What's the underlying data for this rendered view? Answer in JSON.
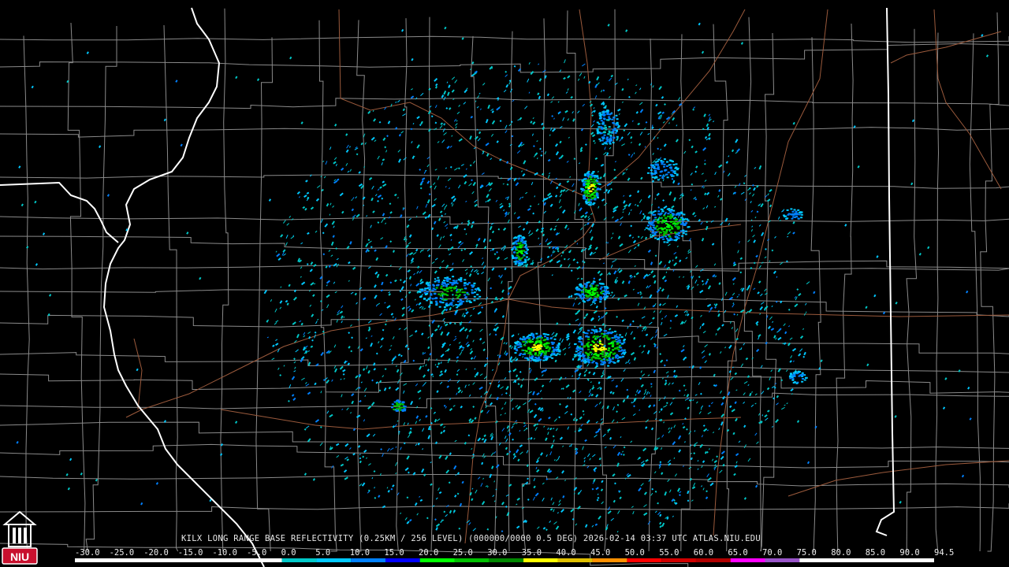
{
  "product": {
    "caption": "KILX LONG RANGE BASE REFLECTIVITY (0.25KM / 256 LEVEL) (000000/0000 0.5 DEG) 2026-02-14 03:37 UTC  ATLAS.NIU.EDU"
  },
  "logo": {
    "text": "NIU",
    "bg_color": "#c8102e"
  },
  "legend": {
    "ticks": [
      "-30.0",
      "-25.0",
      "-20.0",
      "-15.0",
      "-10.0",
      "-5.0",
      "0.0",
      "5.0",
      "10.0",
      "15.0",
      "20.0",
      "25.0",
      "30.0",
      "35.0",
      "40.0",
      "45.0",
      "50.0",
      "55.0",
      "60.0",
      "65.0",
      "70.0",
      "75.0",
      "80.0",
      "85.0",
      "90.0",
      "94.5"
    ],
    "colors": [
      {
        "dbz": -30,
        "color": "#ffffff"
      },
      {
        "dbz": 0,
        "color": "#ffffff"
      },
      {
        "dbz": 0,
        "color": "#00c8c8"
      },
      {
        "dbz": 5,
        "color": "#00c8ff"
      },
      {
        "dbz": 10,
        "color": "#0080ff"
      },
      {
        "dbz": 15,
        "color": "#0000ff"
      },
      {
        "dbz": 20,
        "color": "#00ff00"
      },
      {
        "dbz": 25,
        "color": "#00c000"
      },
      {
        "dbz": 30,
        "color": "#008800"
      },
      {
        "dbz": 35,
        "color": "#ffff00"
      },
      {
        "dbz": 40,
        "color": "#e0c000"
      },
      {
        "dbz": 45,
        "color": "#ff9000"
      },
      {
        "dbz": 50,
        "color": "#ff0000"
      },
      {
        "dbz": 55,
        "color": "#d00000"
      },
      {
        "dbz": 60,
        "color": "#b00000"
      },
      {
        "dbz": 65,
        "color": "#ff00ff"
      },
      {
        "dbz": 70,
        "color": "#9955c9"
      },
      {
        "dbz": 75,
        "color": "#ffffff"
      },
      {
        "dbz": 94.5,
        "color": "#ffffff"
      }
    ]
  },
  "map": {
    "background": "#000000",
    "county_line_color": "#8a8a8a",
    "state_line_color": "#ffffff",
    "road_color": "#9b5a3c",
    "radar_site": "KILX"
  }
}
